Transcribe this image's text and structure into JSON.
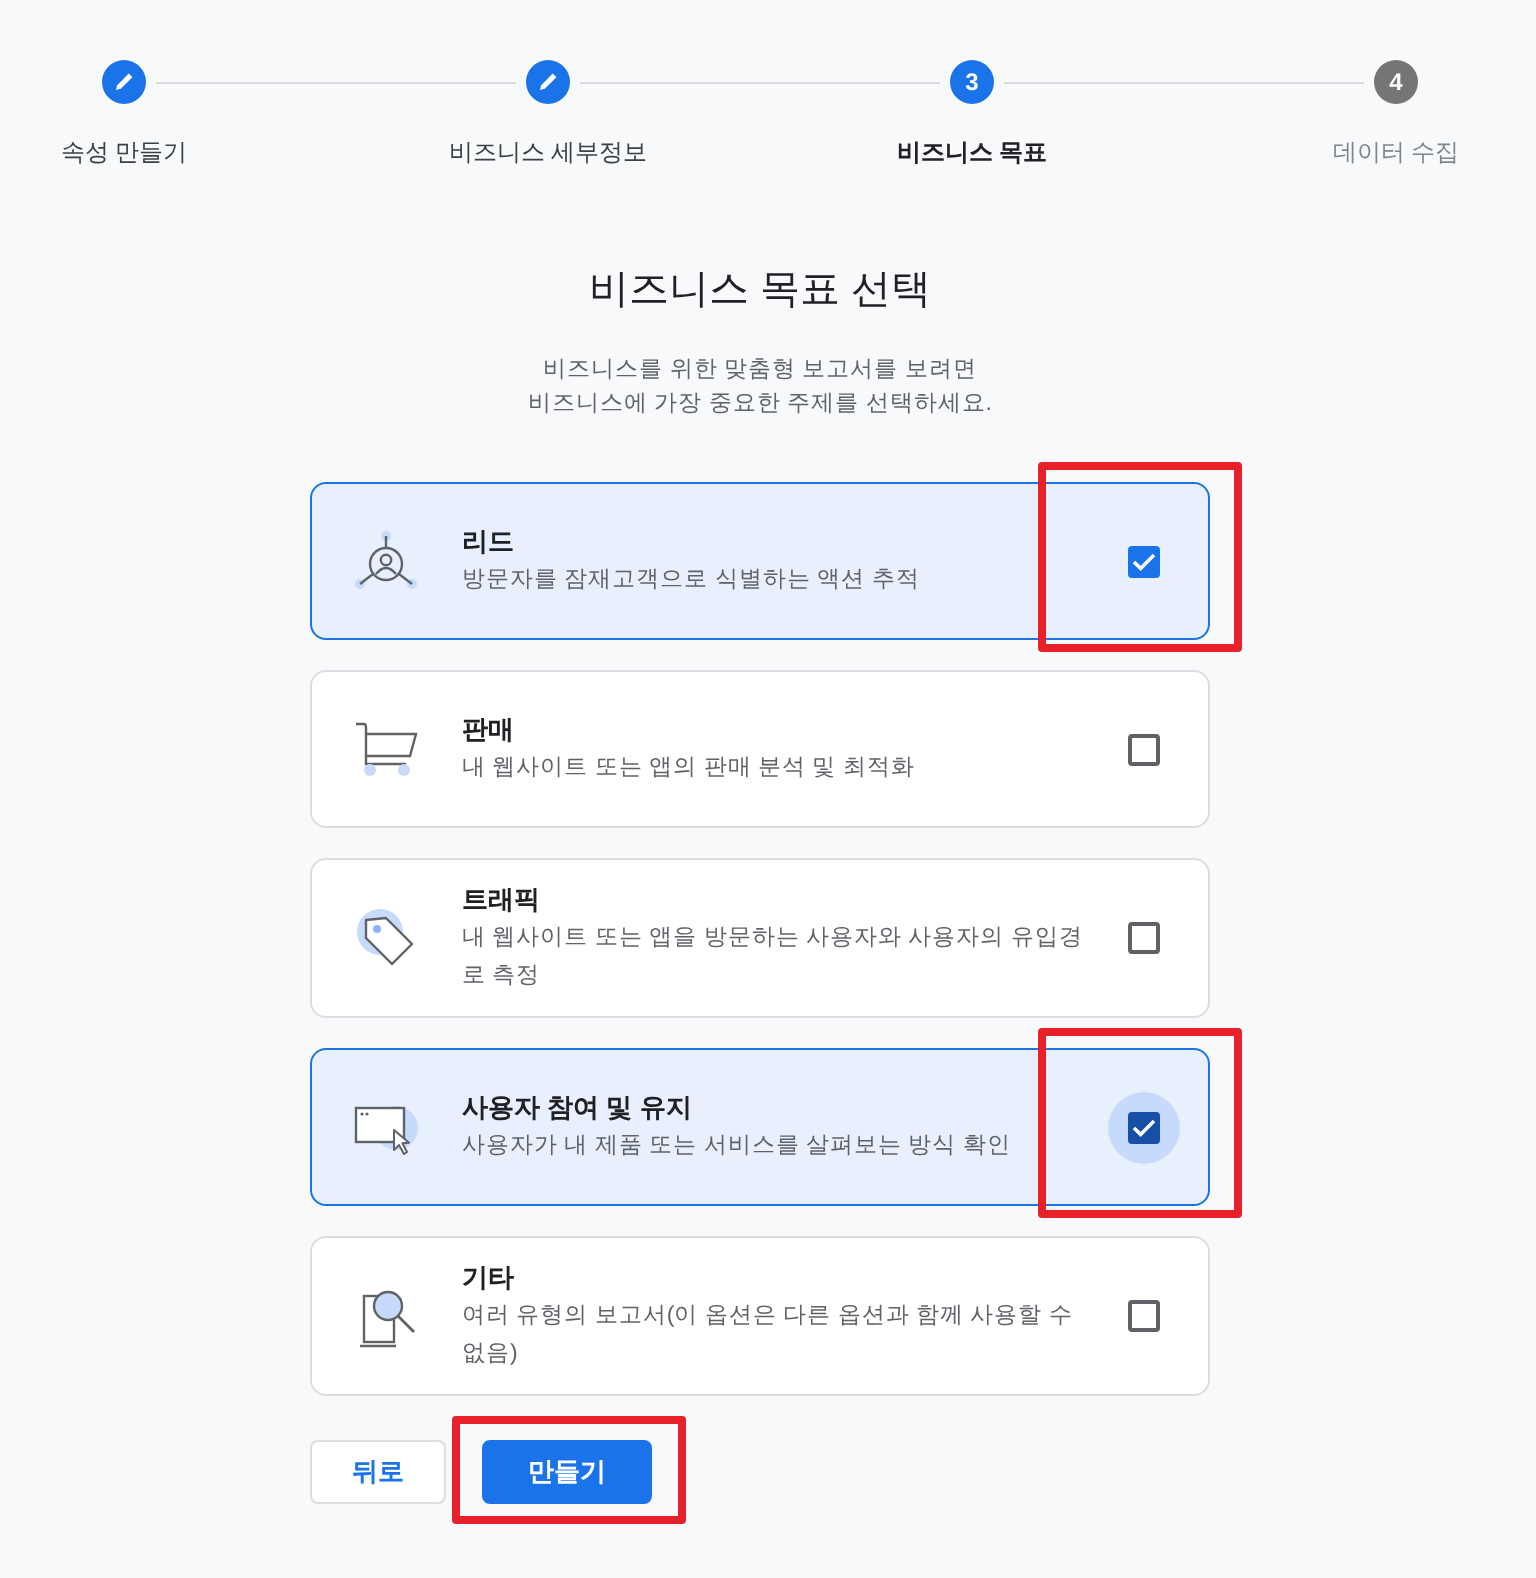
{
  "steps": [
    {
      "label": "속성 만들기",
      "completed": true,
      "current": false
    },
    {
      "label": "비즈니스 세부정보",
      "completed": true,
      "current": false
    },
    {
      "label": "비즈니스 목표",
      "number": "3",
      "completed": false,
      "current": true
    },
    {
      "label": "데이터 수집",
      "number": "4",
      "completed": false,
      "current": false
    }
  ],
  "heading": "비즈니스 목표 선택",
  "subtitle_lines": [
    "비즈니스를 위한 맞춤형 보고서를 보려면",
    "비즈니스에 가장 중요한 주제를 선택하세요."
  ],
  "options": [
    {
      "kind": "lead",
      "title": "리드",
      "description": "방문자를 잠재고객으로 식별하는 액션 추적",
      "checked": true,
      "focused": false,
      "highlighted": true
    },
    {
      "kind": "sales",
      "title": "판매",
      "description": "내 웹사이트 또는 앱의 판매 분석 및 최적화",
      "checked": false,
      "focused": false,
      "highlighted": false
    },
    {
      "kind": "traffic",
      "title": "트래픽",
      "description": "내 웹사이트 또는 앱을 방문하는 사용자와 사용자의 유입경로 측정",
      "checked": false,
      "focused": false,
      "highlighted": false
    },
    {
      "kind": "engagement",
      "title": "사용자 참여 및 유지",
      "description": "사용자가 내 제품 또는 서비스를 살펴보는 방식 확인",
      "checked": true,
      "focused": true,
      "highlighted": true
    },
    {
      "kind": "other",
      "title": "기타",
      "description": "여러 유형의 보고서(이 옵션은 다른 옵션과 함께 사용할 수 없음)",
      "checked": false,
      "focused": false,
      "highlighted": false
    }
  ],
  "buttons": [
    {
      "label": "뒤로",
      "kind": "secondary",
      "highlighted": false
    },
    {
      "label": "만들기",
      "kind": "primary",
      "highlighted": true
    }
  ]
}
